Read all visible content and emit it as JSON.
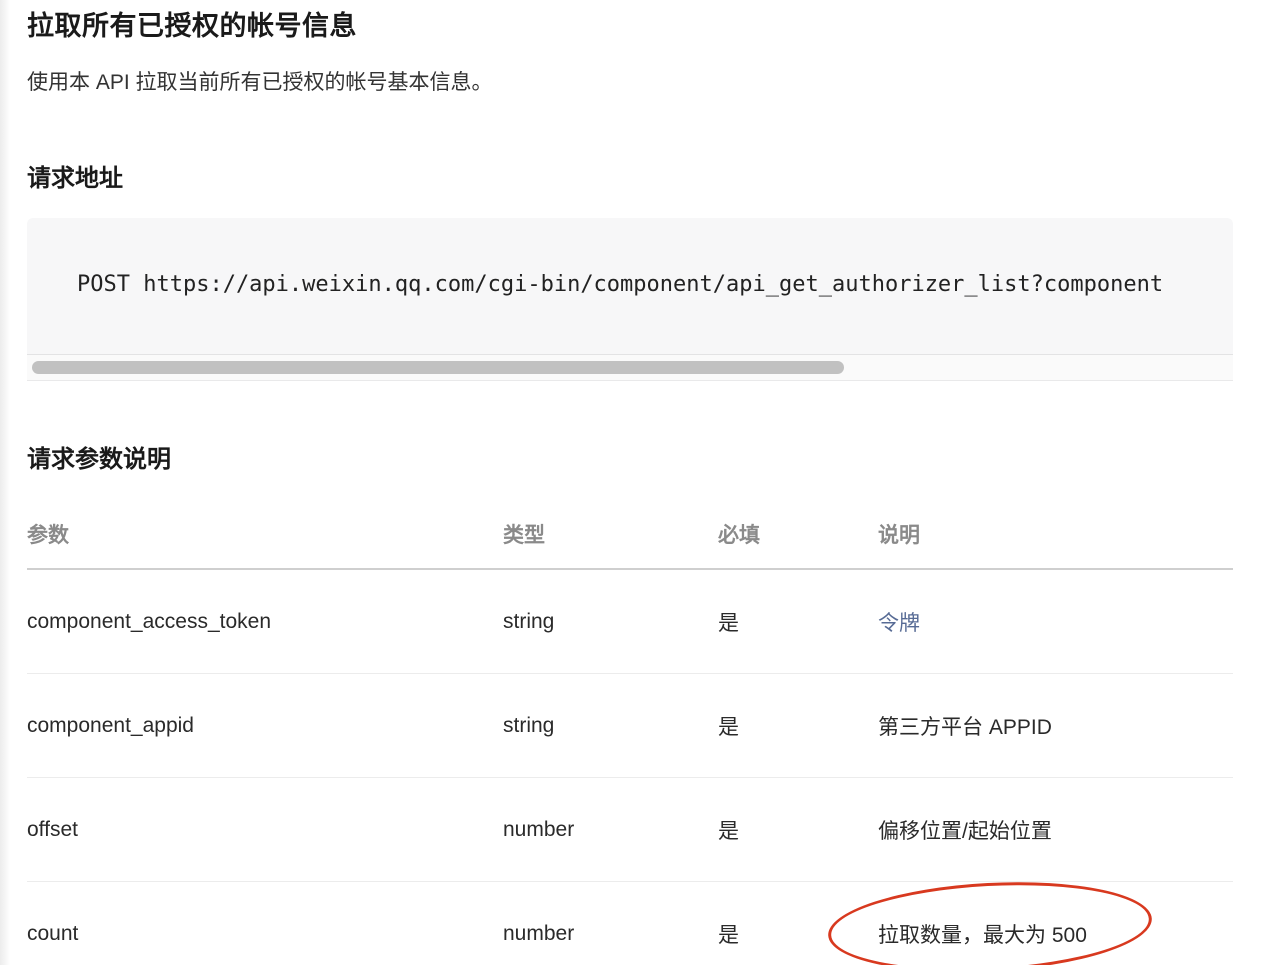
{
  "title": "拉取所有已授权的帐号信息",
  "intro": "使用本 API 拉取当前所有已授权的帐号基本信息。",
  "request_url": {
    "heading": "请求地址",
    "code": "POST https://api.weixin.qq.com/cgi-bin/component/api_get_authorizer_list?component"
  },
  "params": {
    "heading": "请求参数说明",
    "headers": [
      "参数",
      "类型",
      "必填",
      "说明"
    ],
    "rows": [
      {
        "name": "component_access_token",
        "type": "string",
        "required": "是",
        "desc": "令牌"
      },
      {
        "name": "component_appid",
        "type": "string",
        "required": "是",
        "desc": "第三方平台 APPID"
      },
      {
        "name": "offset",
        "type": "number",
        "required": "是",
        "desc": "偏移位置/起始位置"
      },
      {
        "name": "count",
        "type": "number",
        "required": "是",
        "desc": "拉取数量，最大为 500"
      }
    ]
  },
  "colors": {
    "link": "#576b95",
    "annotation": "#d8391f",
    "code_bg": "#f7f7f8"
  }
}
